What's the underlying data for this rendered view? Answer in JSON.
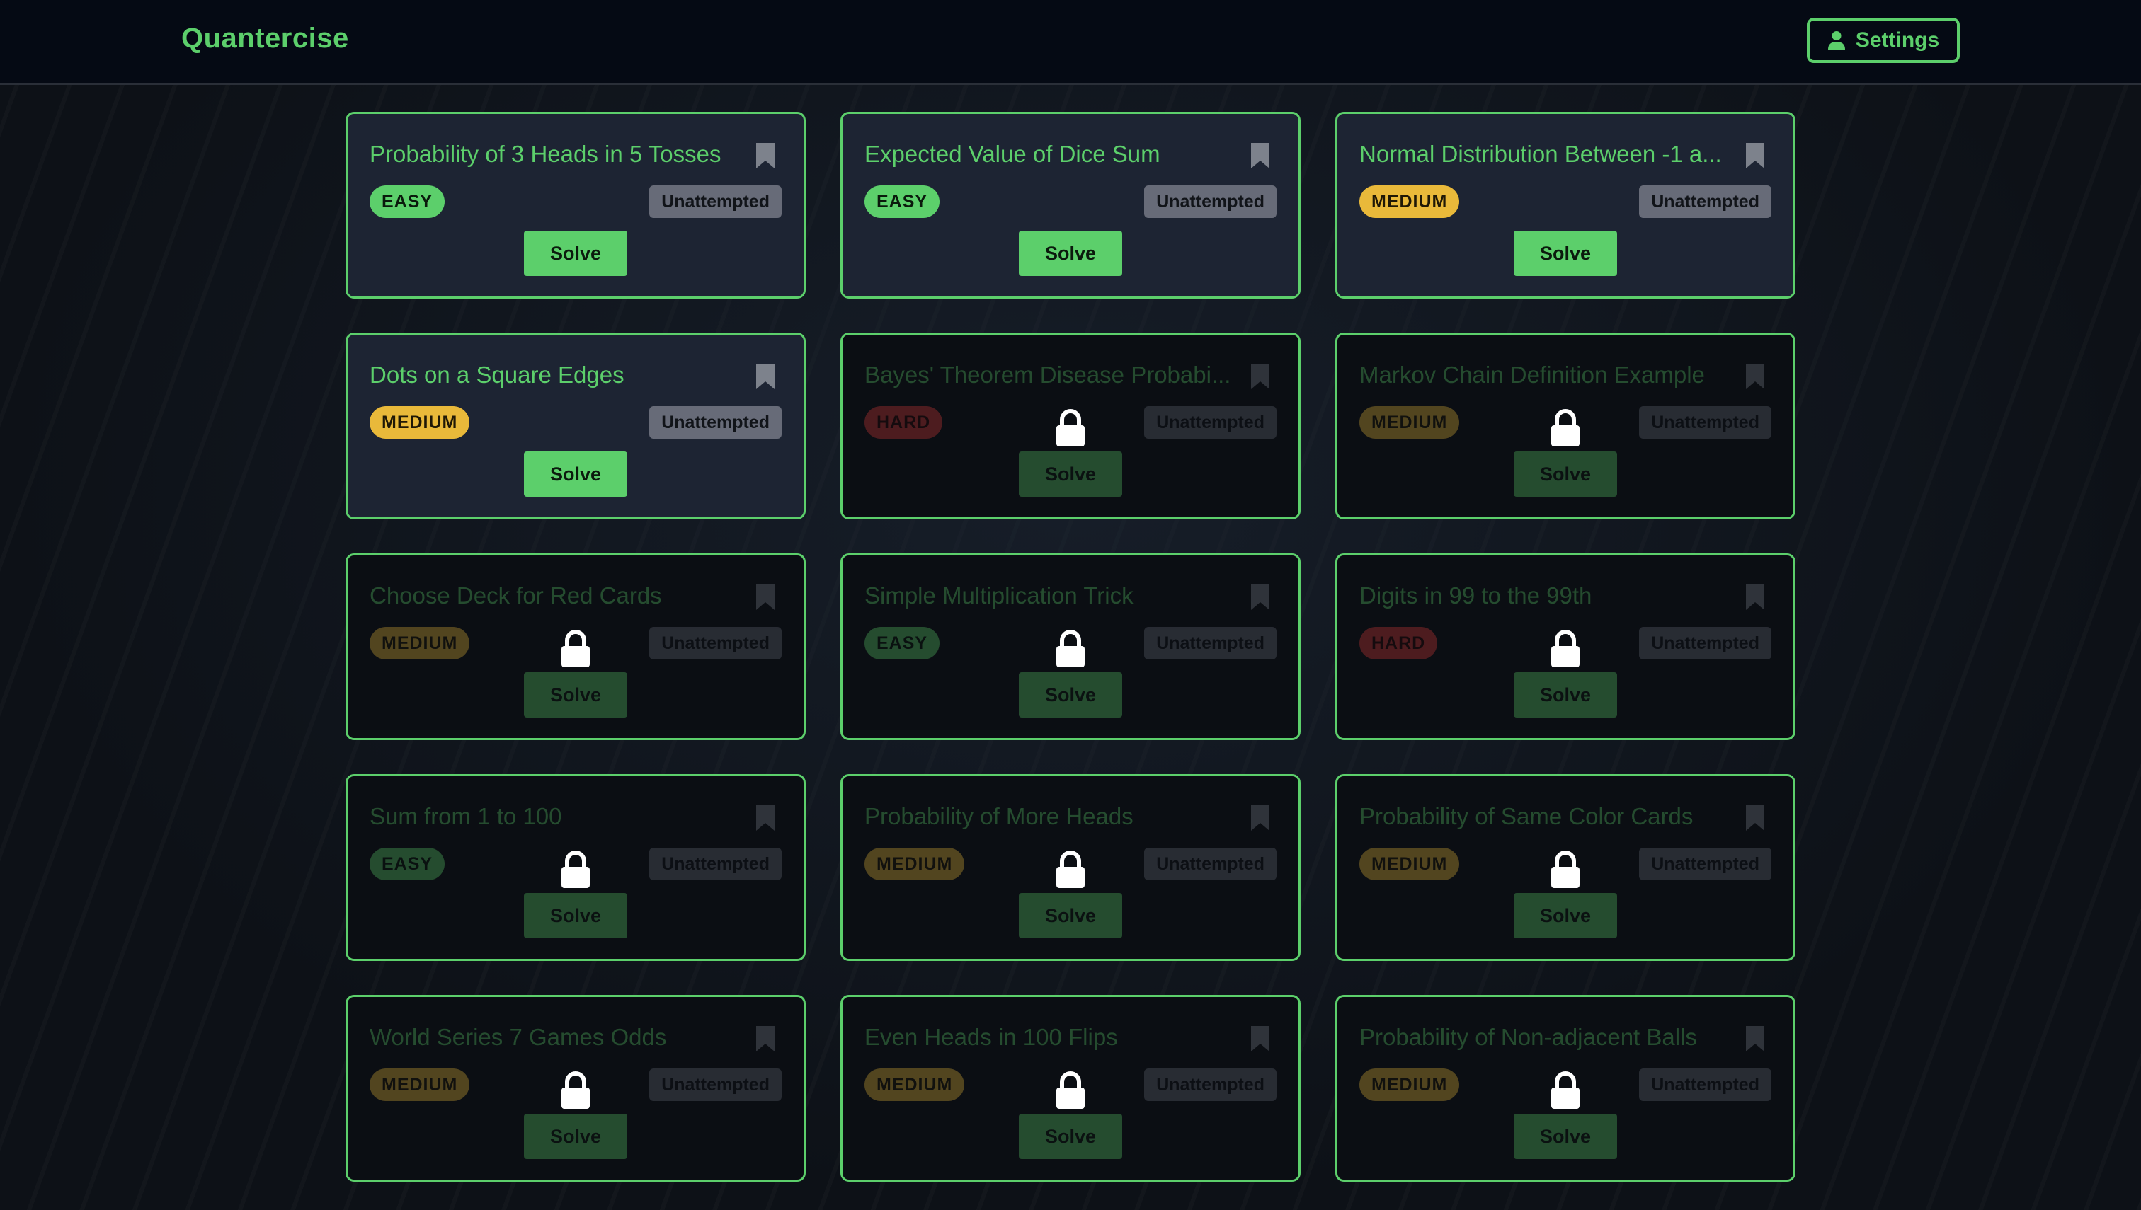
{
  "header": {
    "brand": "Quantercise",
    "settings_label": "Settings"
  },
  "cards": [
    {
      "title": "Probability of 3 Heads in 5 Tosses",
      "difficulty": "EASY",
      "status": "Unattempted",
      "action": "Solve",
      "locked": false
    },
    {
      "title": "Expected Value of Dice Sum",
      "difficulty": "EASY",
      "status": "Unattempted",
      "action": "Solve",
      "locked": false
    },
    {
      "title": "Normal Distribution Between -1 a...",
      "difficulty": "MEDIUM",
      "status": "Unattempted",
      "action": "Solve",
      "locked": false
    },
    {
      "title": "Dots on a Square Edges",
      "difficulty": "MEDIUM",
      "status": "Unattempted",
      "action": "Solve",
      "locked": false
    },
    {
      "title": "Bayes' Theorem Disease Probabi...",
      "difficulty": "HARD",
      "status": "Unattempted",
      "action": "Solve",
      "locked": true
    },
    {
      "title": "Markov Chain Definition Example",
      "difficulty": "MEDIUM",
      "status": "Unattempted",
      "action": "Solve",
      "locked": true
    },
    {
      "title": "Choose Deck for Red Cards",
      "difficulty": "MEDIUM",
      "status": "Unattempted",
      "action": "Solve",
      "locked": true
    },
    {
      "title": "Simple Multiplication Trick",
      "difficulty": "EASY",
      "status": "Unattempted",
      "action": "Solve",
      "locked": true
    },
    {
      "title": "Digits in 99 to the 99th",
      "difficulty": "HARD",
      "status": "Unattempted",
      "action": "Solve",
      "locked": true
    },
    {
      "title": "Sum from 1 to 100",
      "difficulty": "EASY",
      "status": "Unattempted",
      "action": "Solve",
      "locked": true
    },
    {
      "title": "Probability of More Heads",
      "difficulty": "MEDIUM",
      "status": "Unattempted",
      "action": "Solve",
      "locked": true
    },
    {
      "title": "Probability of Same Color Cards",
      "difficulty": "MEDIUM",
      "status": "Unattempted",
      "action": "Solve",
      "locked": true
    },
    {
      "title": "World Series 7 Games Odds",
      "difficulty": "MEDIUM",
      "status": "Unattempted",
      "action": "Solve",
      "locked": true
    },
    {
      "title": "Even Heads in 100 Flips",
      "difficulty": "MEDIUM",
      "status": "Unattempted",
      "action": "Solve",
      "locked": true
    },
    {
      "title": "Probability of Non-adjacent Balls",
      "difficulty": "MEDIUM",
      "status": "Unattempted",
      "action": "Solve",
      "locked": true
    }
  ],
  "icons": {
    "settings": "user-icon",
    "bookmark": "bookmark-icon",
    "lock": "lock-icon"
  },
  "colors": {
    "accent": "#5ccf6b",
    "easy": "#5ccf6b",
    "medium": "#e9b93a",
    "hard": "#d93a3a",
    "status_bg": "#676b78",
    "card_unlocked_bg": "#1d2433",
    "card_locked_bg": "#0b0e13"
  }
}
